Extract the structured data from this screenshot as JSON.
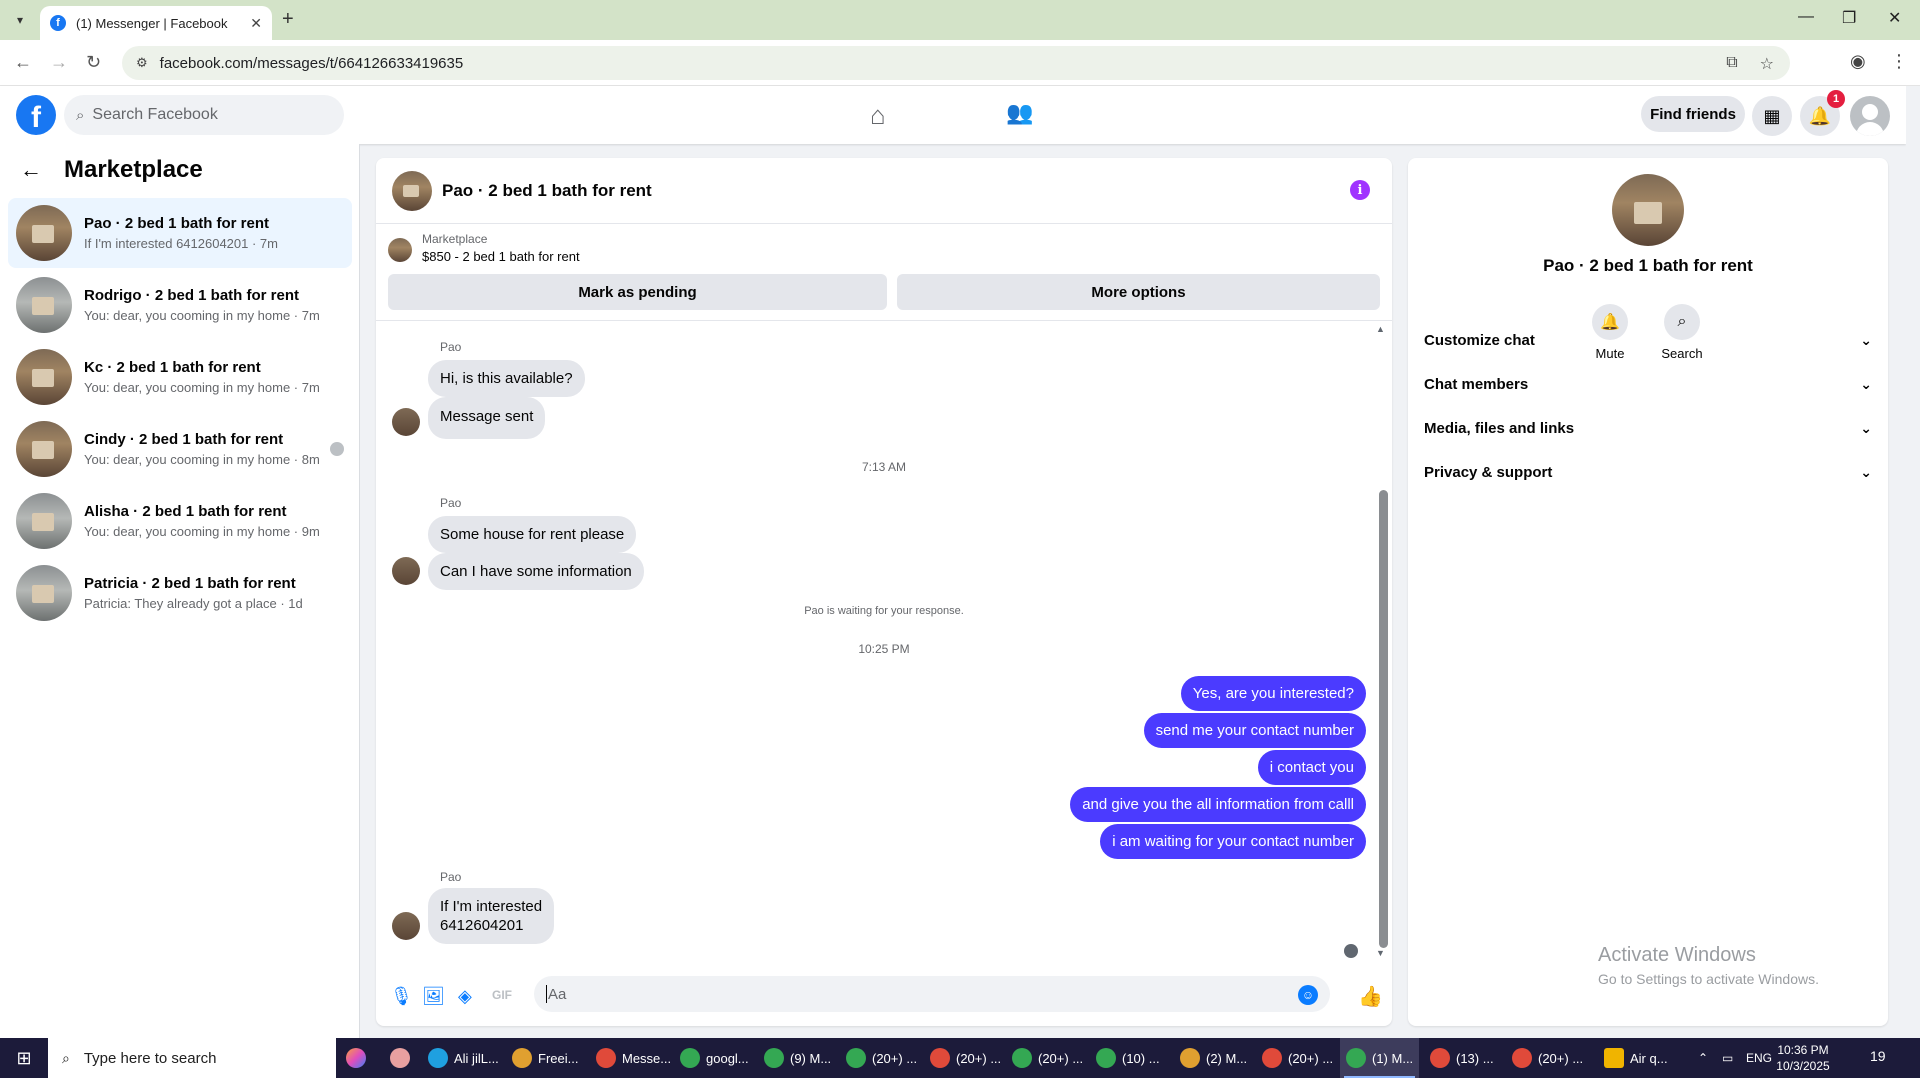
{
  "browser": {
    "tab_title": "(1) Messenger | Facebook",
    "tab_close": "✕",
    "new_tab": "+",
    "url": "facebook.com/messages/t/664126633419635",
    "win_min": "—",
    "win_restore": "❐",
    "win_close": "✕",
    "icons": [
      "chevron-down-icon",
      "facebook-favicon",
      "back-arrow-icon",
      "forward-arrow-icon",
      "reload-icon",
      "site-settings-icon",
      "install-app-icon",
      "bookmark-star-icon",
      "profile-icon",
      "menu-dots-icon"
    ]
  },
  "fb_header": {
    "logo": "f",
    "search_placeholder": "Search Facebook",
    "find_friends": "Find friends",
    "notification_count": "1"
  },
  "sidebar": {
    "title": "Marketplace",
    "conversations": [
      {
        "name": "Pao · 2 bed 1 bath for rent",
        "preview": "If I'm interested 6412604201 · 7m",
        "active": true
      },
      {
        "name": "Rodrigo · 2 bed 1 bath for rent",
        "preview": "You: dear, you cooming in my home · 7m"
      },
      {
        "name": "Kc · 2 bed 1 bath for rent",
        "preview": "You: dear, you cooming in my home · 7m"
      },
      {
        "name": "Cindy · 2 bed 1 bath for rent",
        "preview": "You: dear, you cooming in my home · 8m"
      },
      {
        "name": "Alisha · 2 bed 1 bath for rent",
        "preview": "You: dear, you cooming in my home · 9m"
      },
      {
        "name": "Patricia · 2 bed 1 bath for rent",
        "preview": "Patricia: They already got a place · 1d"
      }
    ]
  },
  "chat": {
    "title": "Pao · 2 bed 1 bath for rent",
    "marketplace_label": "Marketplace",
    "listing": "$850 - 2 bed 1 bath for rent",
    "mark_pending": "Mark as pending",
    "more_options": "More options",
    "sender": "Pao",
    "messages_group1": [
      "Hi, is this available?",
      "Message sent"
    ],
    "time1": "7:13 AM",
    "messages_group2": [
      "Some house for rent please",
      "Can I have some information"
    ],
    "waiting_notice": "Pao is waiting for your response.",
    "time2": "10:25 PM",
    "outgoing": [
      "Yes, are you interested?",
      "send me your contact number",
      "i contact you",
      "and give you the all information from calll",
      "i am waiting for your contact number"
    ],
    "last_incoming_line1": "If I'm interested",
    "last_incoming_line2": "6412604201",
    "composer_placeholder": "Aa"
  },
  "info_panel": {
    "name": "Pao · 2 bed 1 bath for rent",
    "mute": "Mute",
    "search": "Search",
    "sections": [
      "Customize chat",
      "Chat members",
      "Media, files and links",
      "Privacy & support"
    ],
    "watermark_title": "Activate Windows",
    "watermark_sub": "Go to Settings to activate Windows."
  },
  "taskbar": {
    "search_placeholder": "Type here to search",
    "apps": [
      "Ali jilL...",
      "Freei...",
      "Messe...",
      "googl...",
      "(9) M...",
      "(20+) ...",
      "(20+) ...",
      "(20+) ...",
      "(10) ...",
      "(2) M...",
      "(20+) ...",
      "(1) M...",
      "(13) ...",
      "(20+) ..."
    ],
    "weather": "Air q...",
    "language": "ENG",
    "time": "10:36 PM",
    "date": "10/3/2025",
    "notif_count": "19"
  }
}
